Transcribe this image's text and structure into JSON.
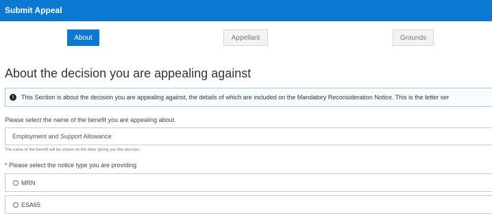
{
  "header": {
    "title": "Submit Appeal"
  },
  "steps": [
    {
      "label": "About"
    },
    {
      "label": "Appellant"
    },
    {
      "label": "Grounds"
    }
  ],
  "section": {
    "title": "About the decision you are appealing against"
  },
  "info": {
    "icon": "info-icon",
    "text": "This Section is about the decision you are appealing against, the details of which are included on the Mandatory Reconsideration Notice. This is the letter ser"
  },
  "benefit": {
    "label": "Please select the name of the benefit you are appealing about.",
    "value": "Employment and Support Allowance",
    "helper": "The name of the benefit will be shown on the letter giving you the decision."
  },
  "notice": {
    "required_mark": "*",
    "label": "Please select the notice type you are providing",
    "options": [
      {
        "label": "MRN"
      },
      {
        "label": "ESA65"
      }
    ]
  },
  "colors": {
    "accent": "#0b78d1",
    "required": "#d0021b"
  }
}
